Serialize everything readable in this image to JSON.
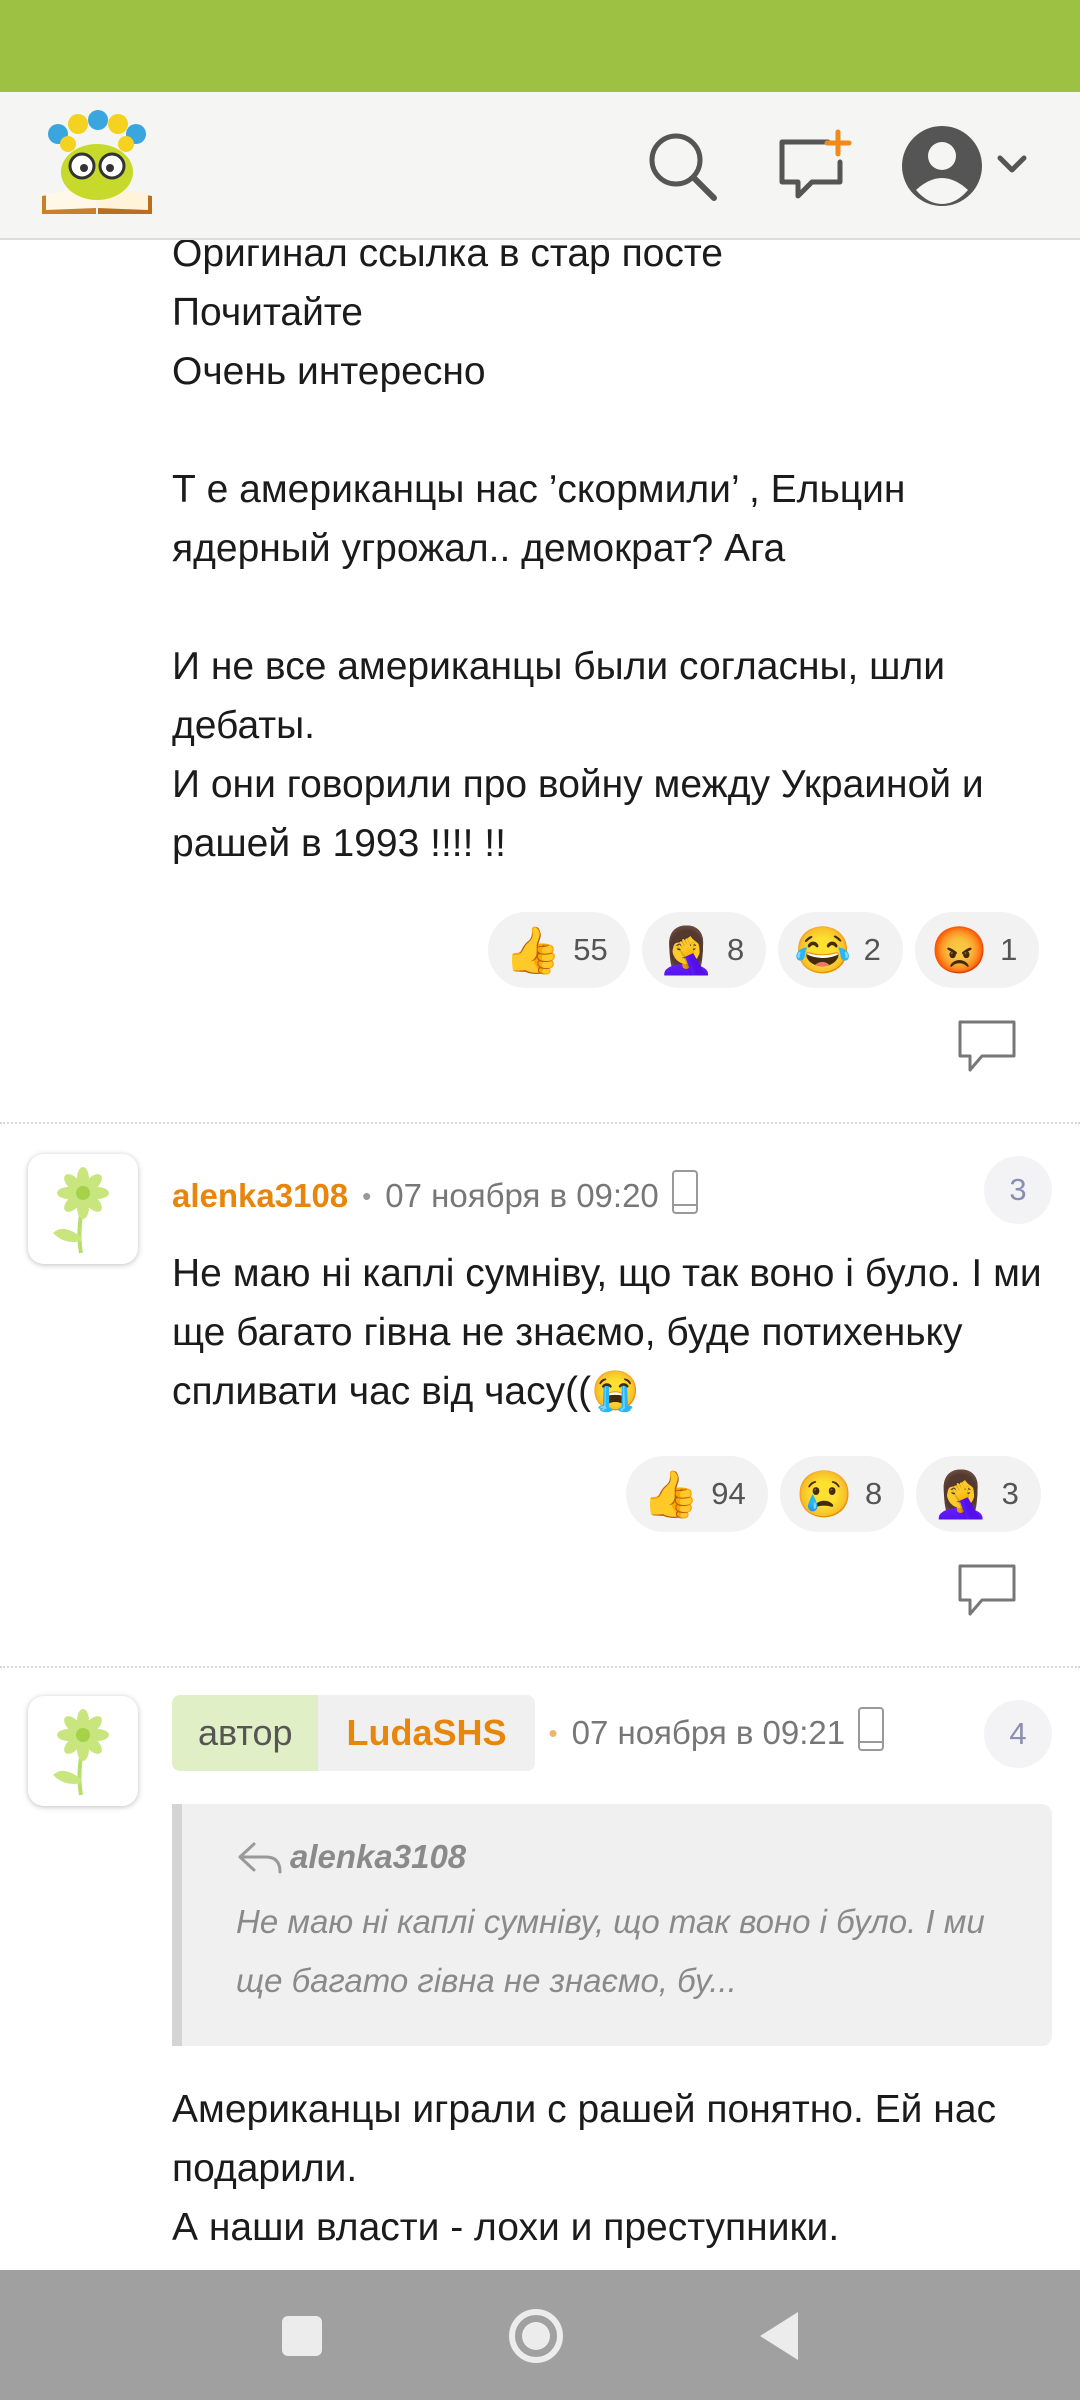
{
  "header": {
    "logo_alt": "logo",
    "icons": [
      "search-icon",
      "new-post-icon",
      "profile-icon",
      "chevron-down-icon"
    ]
  },
  "post": {
    "text": "Оригинал ссылка в стар посте\nПочитайте\nОчень интересно\n\nТ е американцы нас ’скормили’ , Ельцин ядерный угрожал.. демократ? Ага\n\nИ не все американцы были согласны, шли дебаты.\nИ они говорили про войну между Украиной и рашей в 1993 !!!! !!",
    "reactions": [
      {
        "emoji": "👍",
        "count": "55"
      },
      {
        "emoji": "🤦‍♀️",
        "count": "8"
      },
      {
        "emoji": "😂",
        "count": "2"
      },
      {
        "emoji": "😡",
        "count": "1"
      }
    ]
  },
  "comments": [
    {
      "username": "alenka3108",
      "date": "07 ноября в 09:20",
      "number": "3",
      "text": "Не маю ні каплі сумніву, що так воно і було. І ми ще багато гівна не знаємо, буде потихеньку спливати час від часу((😭",
      "reactions": [
        {
          "emoji": "👍",
          "count": "94"
        },
        {
          "emoji": "😢",
          "count": "8"
        },
        {
          "emoji": "🤦‍♀️",
          "count": "3"
        }
      ]
    },
    {
      "author_label": "автор",
      "username": "LudaSHS",
      "date": "07 ноября в 09:21",
      "number": "4",
      "quote_author": "alenka3108",
      "quote_text": "Не маю ні каплі сумніву, що так воно і було. І ми ще багато гівна не знаємо, бу...",
      "text": "Американцы играли с рашей понятно. Ей нас подарили.\nА наши власти - лохи и преступники."
    }
  ],
  "colors": {
    "status_bar": "#9dc243",
    "accent_orange": "#e8860c",
    "author_badge_bg": "#e1efc6"
  }
}
